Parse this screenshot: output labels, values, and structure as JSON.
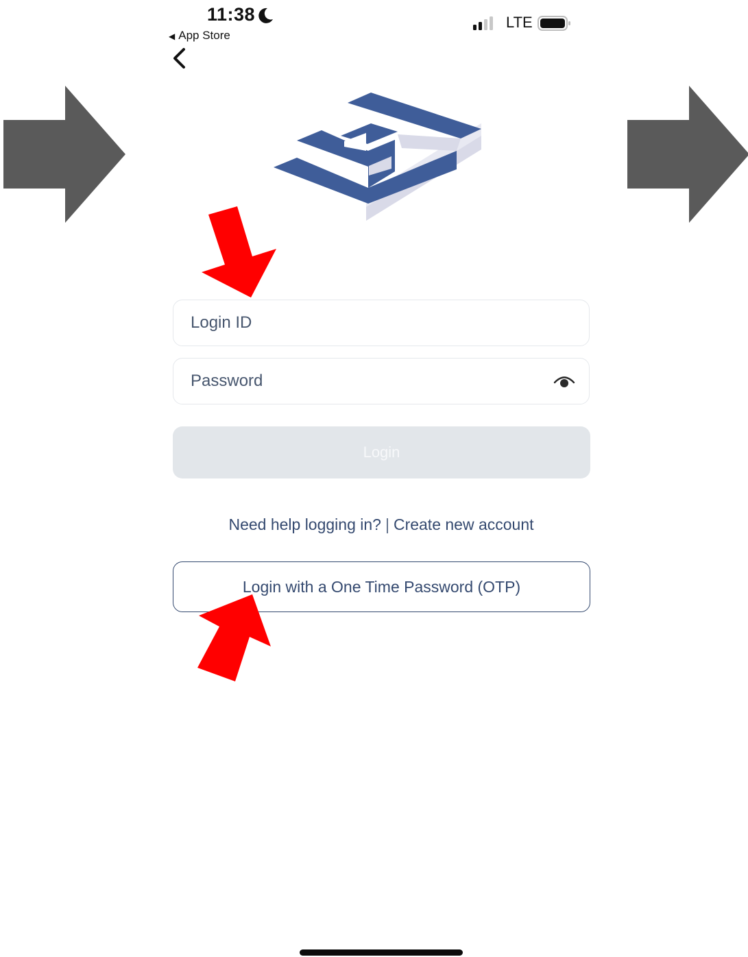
{
  "status_bar": {
    "time": "11:38",
    "back_app": "App Store",
    "network": "LTE"
  },
  "form": {
    "login_id_placeholder": "Login ID",
    "password_placeholder": "Password",
    "login_button": "Login"
  },
  "links": {
    "help": "Need help logging in?",
    "separator": "|",
    "create_account": "Create new account"
  },
  "otp_button": "Login with a One Time Password (OTP)",
  "icons": [
    "moon-icon",
    "signal-icon",
    "battery-icon",
    "back-chevron-icon",
    "app-logo",
    "eye-icon"
  ],
  "colors": {
    "brand_blue": "#3f5d99",
    "link_blue": "#34496f",
    "disabled_button": "#e2e6ea",
    "annotation_red": "#ff0000",
    "annotation_gray": "#5a5a5a"
  }
}
